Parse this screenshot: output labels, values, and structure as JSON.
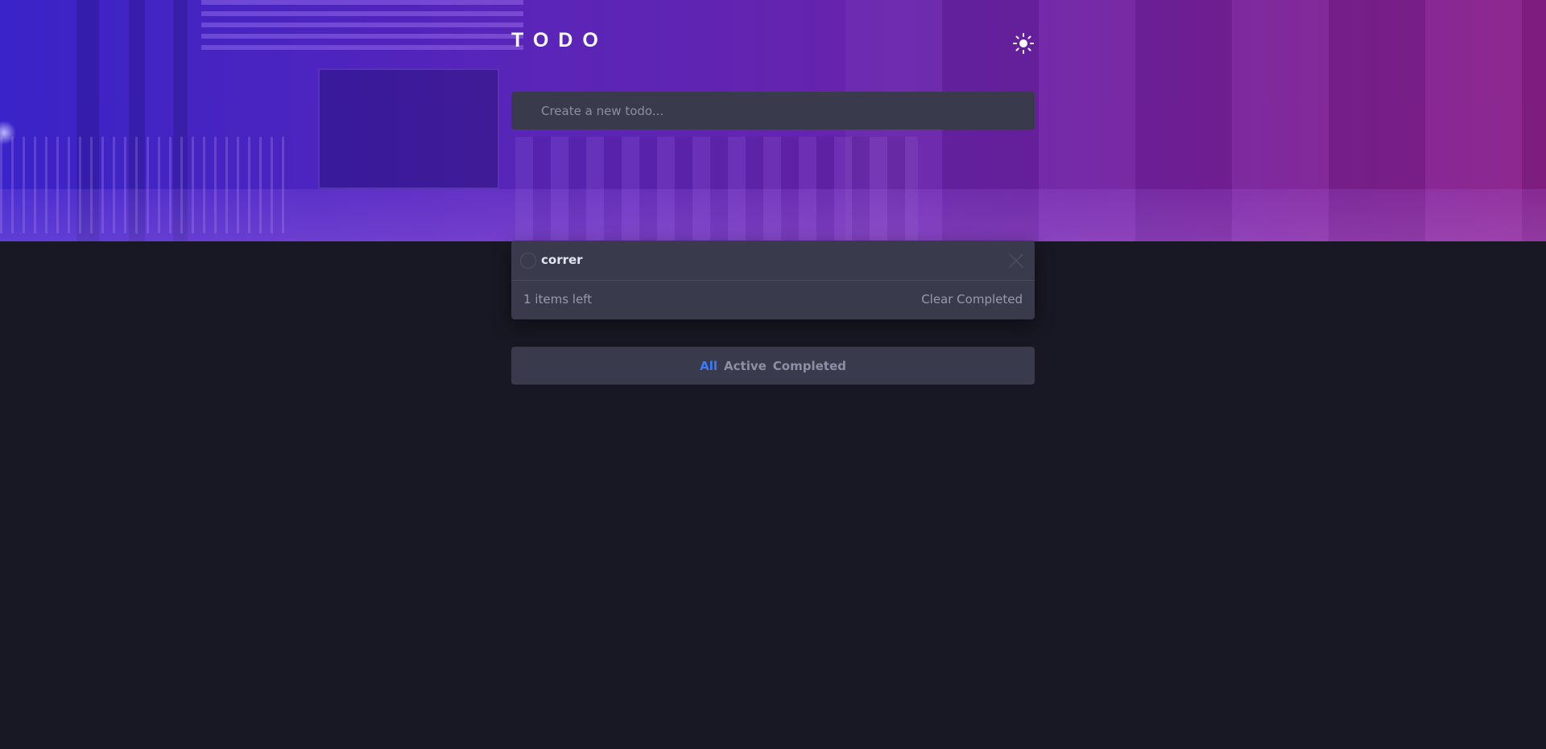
{
  "header": {
    "title": "TODO",
    "theme_icon": "sun-icon"
  },
  "new_todo": {
    "placeholder": "Create a new todo..."
  },
  "todos": [
    {
      "text": "correr",
      "completed": false
    }
  ],
  "footer": {
    "items_left": "1 items left",
    "clear_label": "Clear Completed"
  },
  "filters": {
    "all": "All",
    "active": "Active",
    "completed": "Completed",
    "selected": "All"
  },
  "colors": {
    "accent": "#3a7bfd",
    "background": "#181824",
    "card": "#393a4c"
  }
}
